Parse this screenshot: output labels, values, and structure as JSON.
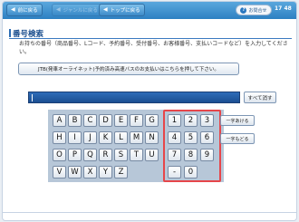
{
  "topbar": {
    "back_label": "前に戻る",
    "genre_label": "ジャンルに戻る",
    "top_label": "トップに戻る",
    "help_label": "お問合せ",
    "time": "17 48"
  },
  "main": {
    "title": "番号検索",
    "description": "お持ちの番号（商品番号、Lコード、予約番号、受付番号、お客様番号、支払いコードなど）を入力してください。",
    "jtb_button": "JTB(発車オーライネット)予約済み高速バスのお支払いはこちらを押して下さい。",
    "input_value": "",
    "clear_button": "すべて消す"
  },
  "keypad": {
    "letters": [
      "A",
      "B",
      "C",
      "D",
      "E",
      "F",
      "G",
      "H",
      "I",
      "J",
      "K",
      "L",
      "M",
      "N",
      "O",
      "P",
      "Q",
      "R",
      "S",
      "T",
      "U",
      "V",
      "W",
      "X",
      "Y",
      "Z"
    ],
    "numbers": [
      "1",
      "2",
      "3",
      "4",
      "5",
      "6",
      "7",
      "8",
      "9",
      "-",
      "0"
    ],
    "forward_label": "一字あける",
    "backspace_label": "一字もどる"
  },
  "colors": {
    "accent_blue": "#2d80c2",
    "highlight_red": "#e6464a"
  }
}
